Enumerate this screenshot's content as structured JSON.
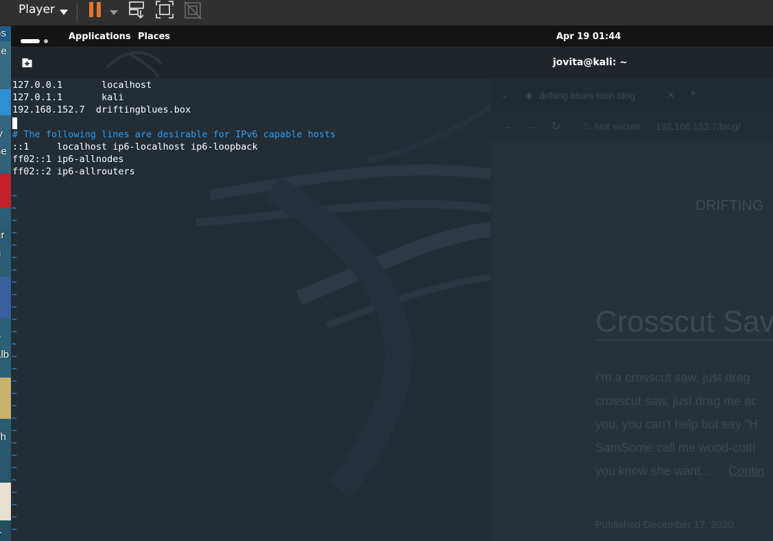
{
  "player": {
    "label": "Player"
  },
  "kali_panel": {
    "applications": "Applications",
    "places": "Places",
    "clock": "Apr 19  01:44"
  },
  "terminal": {
    "title": "jovita@kali: ~",
    "lines": [
      "127.0.0.1       localhost",
      "127.0.1.1       kali",
      "192.168.152.7  driftingblues.box",
      "",
      "# The following lines are desirable for IPv6 capable hosts",
      "::1     localhost ip6-localhost ip6-loopback",
      "ff02::1 ip6-allnodes",
      "ff02::2 ip6-allrouters"
    ],
    "tilde": "~"
  },
  "browser_ghost": {
    "tab_title": "drifting blues tech blog",
    "not_secure": "Not secure",
    "url": "192.168.152.7/blog/",
    "site_title": "DRIFTING",
    "post_title": "Crosscut Sav",
    "excerpt": [
      "I'm a crosscut saw, just drag",
      "crosscut saw, just drag me ac",
      "you, you can't help but say \"H",
      "SamSome call me wood-cutti",
      "you know she want..."
    ],
    "continue_link": "Contin",
    "published": "Published December 17, 2020"
  },
  "desktop_fragments": [
    "os",
    "ge",
    "iv",
    "he",
    "ur",
    "g",
    "e",
    "alb",
    "sh",
    "tr"
  ],
  "colors": {
    "accent_orange": "#e8742c",
    "comment_blue": "#2f9cf2",
    "tilde_blue": "#2f8fe0"
  }
}
